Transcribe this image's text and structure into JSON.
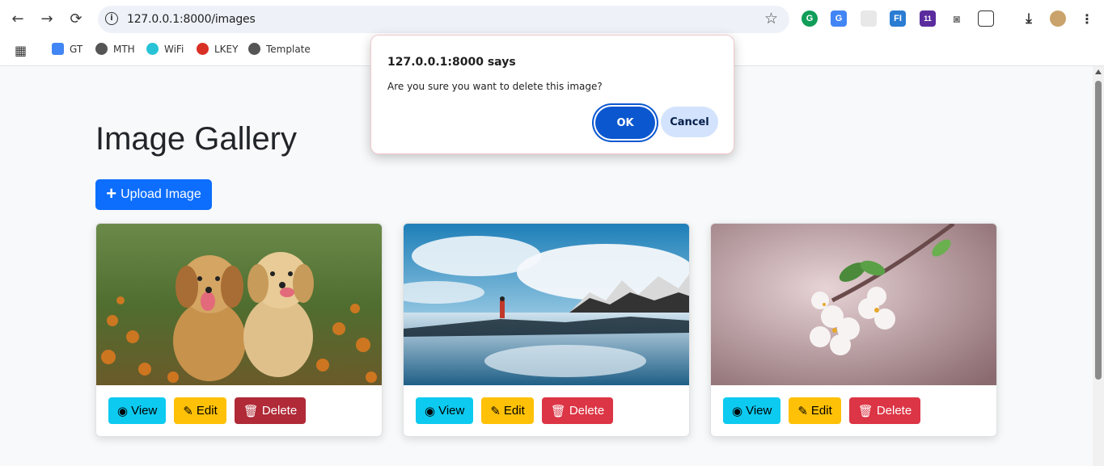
{
  "browser": {
    "url": "127.0.0.1:8000/images",
    "bookmarks": [
      {
        "label": "GT",
        "icon": "google-translate-icon"
      },
      {
        "label": "MTH",
        "icon": "globe-icon"
      },
      {
        "label": "WiFi",
        "icon": "tp-link-icon"
      },
      {
        "label": "LKEY",
        "icon": "key-icon"
      },
      {
        "label": "Template",
        "icon": "globe-icon"
      }
    ],
    "extension_badge": "11"
  },
  "page": {
    "title": "Image Gallery",
    "upload_label": "Upload Image",
    "cards": [
      {
        "image": "two-golden-retriever-puppies-in-flowers",
        "view": "View",
        "edit": "Edit",
        "delete": "Delete"
      },
      {
        "image": "person-at-lake-with-mountains-reflection",
        "view": "View",
        "edit": "Edit",
        "delete": "Delete"
      },
      {
        "image": "white-blossom-on-branch",
        "view": "View",
        "edit": "Edit",
        "delete": "Delete"
      }
    ]
  },
  "dialog": {
    "title": "127.0.0.1:8000 says",
    "message": "Are you sure you want to delete this image?",
    "ok_label": "OK",
    "cancel_label": "Cancel"
  },
  "colors": {
    "primary": "#0d6efd",
    "info": "#0dcaf0",
    "warning": "#ffc107",
    "danger": "#dc3545",
    "dialog_ok": "#0b57d0"
  }
}
